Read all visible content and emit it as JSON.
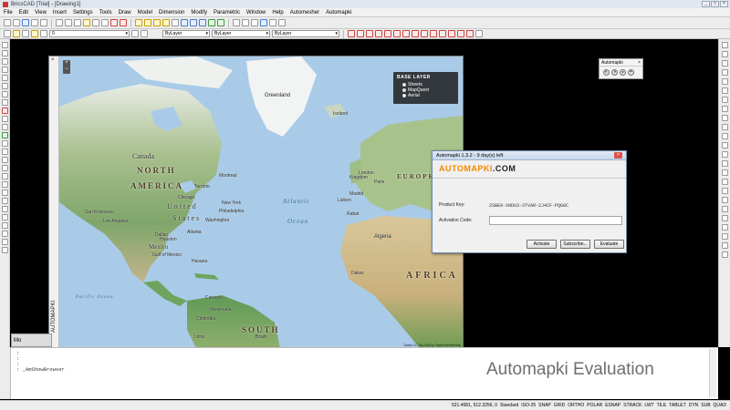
{
  "window": {
    "title": "BricsCAD [Trial] - [Drawing1]",
    "controls": [
      "_",
      "□",
      "×"
    ]
  },
  "menu": [
    "File",
    "Edit",
    "View",
    "Insert",
    "Settings",
    "Tools",
    "Draw",
    "Model",
    "Dimension",
    "Modify",
    "Parametric",
    "Window",
    "Help",
    "Automesher",
    "Automapki"
  ],
  "toolbar": {
    "layer_value": "0",
    "color_value": "ByLayer",
    "linetype_value": "ByLayer",
    "lineweight_value": "ByLayer"
  },
  "map_window": {
    "close": "×",
    "side_label": "AUTOMAPKI",
    "zoom_plus": "+",
    "zoom_minus": "−",
    "attribution": "Data CC-By-SA by OpenStreetMap"
  },
  "map_labels": {
    "north_america_1": "NORTH",
    "north_america_2": "AMERICA",
    "united_states_1": "United",
    "united_states_2": "States",
    "canada": "Canada",
    "mexico": "Mexico",
    "atlantic_1": "Atlantic",
    "atlantic_2": "Ocean",
    "europe": "EUROPE",
    "africa": "AFRICA",
    "south_1": "SOUTH",
    "greenland": "Greenland",
    "iceland": "Iceland",
    "algeria": "Algeria",
    "new_york": "New York",
    "chicago": "Chicago",
    "washington": "Washington",
    "philadelphia": "Philadelphia",
    "toronto": "Toronto",
    "montreal": "Montreal",
    "san_francisco": "San Francisco",
    "los_angeles": "Los Angeles",
    "houston": "Houston",
    "dallas": "Dallas",
    "atlanta": "Atlanta",
    "havana": "Havana",
    "caracas": "Caracas",
    "lima": "Lima",
    "madrid": "Madrid",
    "london": "London",
    "paris": "Paris",
    "lisbon": "Lisbon",
    "rabat": "Rabat",
    "dakar": "Dakar",
    "kingdom": "Kingdom",
    "pacific_1": "Pacific Ocean",
    "colombia": "Colombia",
    "brazil": "Brazil",
    "venezuela": "Venezuela",
    "gulf": "Gulf of Mexico"
  },
  "base_layer": {
    "title": "BASE LAYER",
    "options": [
      {
        "label": "Streets",
        "selected": false
      },
      {
        "label": "MapQuest",
        "selected": true
      },
      {
        "label": "Aerial",
        "selected": false
      }
    ]
  },
  "automapki_toolbar": {
    "title": "Automapki",
    "close": "×",
    "icons": [
      "◐",
      "◑",
      "◒",
      "◓"
    ]
  },
  "dialog": {
    "title": "Automapki 1.3.2 - 9 day(s) left",
    "close": "×",
    "logo_auto": "AUTOMAPKI",
    "logo_com": ".COM",
    "product_key_label": "Product Key:",
    "product_key_value": "2SBE9-XNDU3-3TVAR-2J4CF-PQG8C",
    "activation_code_label": "Activation Code:",
    "activation_code_value": "",
    "buttons": {
      "activate": "Activate",
      "subscribe": "Subscribe...",
      "evaluate": "Evaluate"
    }
  },
  "command": {
    "tab_label": "Mo",
    "lines": [
      ":",
      ":",
      ":",
      ": _AmShowBrowser"
    ],
    "watermark": "Automapki Evaluation"
  },
  "status": {
    "coords": "521.4681, 512.3256, 0",
    "style": "Standard",
    "iso": "ISO-25",
    "toggles": [
      "SNAP",
      "GRID",
      "ORTHO",
      "POLAR",
      "ESNAP",
      "STRACK",
      "LWT",
      "TILE",
      "TABLET",
      "DYN",
      "SUB",
      "QUAD"
    ]
  },
  "colors": {
    "logo_orange": "#f08a00",
    "accent": "#4a7bc8"
  }
}
